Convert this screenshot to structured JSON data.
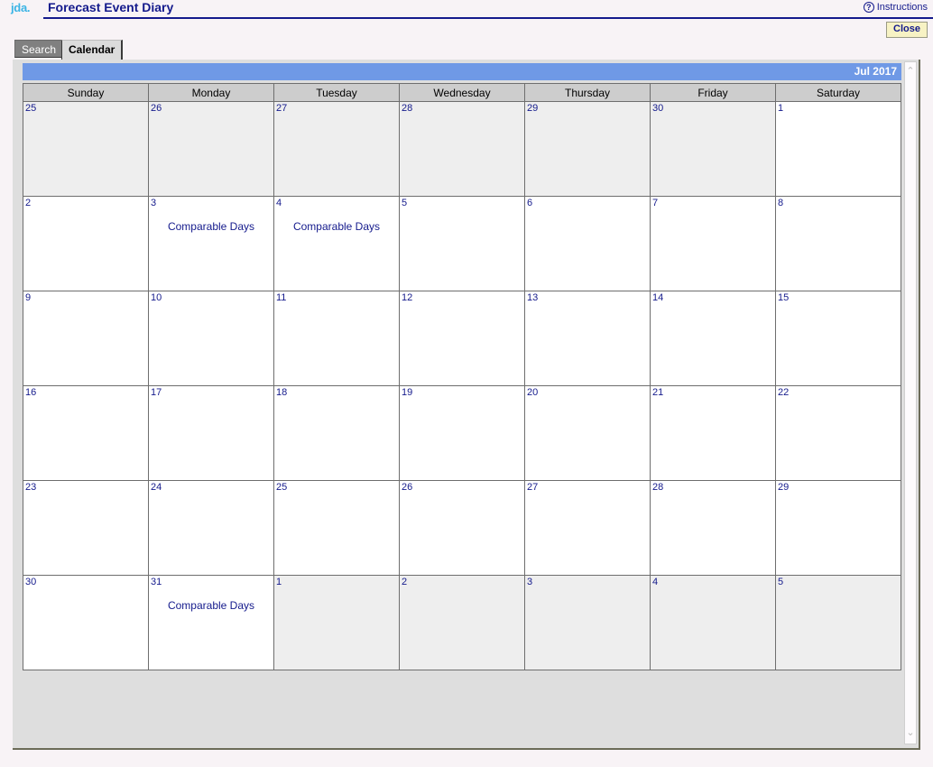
{
  "header": {
    "logo": "jda.",
    "title": "Forecast Event Diary",
    "instructions_label": "Instructions",
    "instructions_icon": "question-circle-icon",
    "close_label": "Close"
  },
  "tabs": [
    {
      "label": "Search",
      "active": false
    },
    {
      "label": "Calendar",
      "active": true
    }
  ],
  "calendar": {
    "month_label": "Jul 2017",
    "weekday_headers": [
      "Sunday",
      "Monday",
      "Tuesday",
      "Wednesday",
      "Thursday",
      "Friday",
      "Saturday"
    ],
    "event_label": "Comparable Days",
    "weeks": [
      [
        {
          "day": "25",
          "other_month": true,
          "event": ""
        },
        {
          "day": "26",
          "other_month": true,
          "event": ""
        },
        {
          "day": "27",
          "other_month": true,
          "event": ""
        },
        {
          "day": "28",
          "other_month": true,
          "event": ""
        },
        {
          "day": "29",
          "other_month": true,
          "event": ""
        },
        {
          "day": "30",
          "other_month": true,
          "event": ""
        },
        {
          "day": "1",
          "other_month": false,
          "event": ""
        }
      ],
      [
        {
          "day": "2",
          "other_month": false,
          "event": ""
        },
        {
          "day": "3",
          "other_month": false,
          "event": "Comparable Days"
        },
        {
          "day": "4",
          "other_month": false,
          "event": "Comparable Days"
        },
        {
          "day": "5",
          "other_month": false,
          "event": ""
        },
        {
          "day": "6",
          "other_month": false,
          "event": ""
        },
        {
          "day": "7",
          "other_month": false,
          "event": ""
        },
        {
          "day": "8",
          "other_month": false,
          "event": ""
        }
      ],
      [
        {
          "day": "9",
          "other_month": false,
          "event": ""
        },
        {
          "day": "10",
          "other_month": false,
          "event": ""
        },
        {
          "day": "11",
          "other_month": false,
          "event": ""
        },
        {
          "day": "12",
          "other_month": false,
          "event": ""
        },
        {
          "day": "13",
          "other_month": false,
          "event": ""
        },
        {
          "day": "14",
          "other_month": false,
          "event": ""
        },
        {
          "day": "15",
          "other_month": false,
          "event": ""
        }
      ],
      [
        {
          "day": "16",
          "other_month": false,
          "event": ""
        },
        {
          "day": "17",
          "other_month": false,
          "event": ""
        },
        {
          "day": "18",
          "other_month": false,
          "event": ""
        },
        {
          "day": "19",
          "other_month": false,
          "event": ""
        },
        {
          "day": "20",
          "other_month": false,
          "event": ""
        },
        {
          "day": "21",
          "other_month": false,
          "event": ""
        },
        {
          "day": "22",
          "other_month": false,
          "event": ""
        }
      ],
      [
        {
          "day": "23",
          "other_month": false,
          "event": ""
        },
        {
          "day": "24",
          "other_month": false,
          "event": ""
        },
        {
          "day": "25",
          "other_month": false,
          "event": ""
        },
        {
          "day": "26",
          "other_month": false,
          "event": ""
        },
        {
          "day": "27",
          "other_month": false,
          "event": ""
        },
        {
          "day": "28",
          "other_month": false,
          "event": ""
        },
        {
          "day": "29",
          "other_month": false,
          "event": ""
        }
      ],
      [
        {
          "day": "30",
          "other_month": false,
          "event": ""
        },
        {
          "day": "31",
          "other_month": false,
          "event": "Comparable Days"
        },
        {
          "day": "1",
          "other_month": true,
          "event": ""
        },
        {
          "day": "2",
          "other_month": true,
          "event": ""
        },
        {
          "day": "3",
          "other_month": true,
          "event": ""
        },
        {
          "day": "4",
          "other_month": true,
          "event": ""
        },
        {
          "day": "5",
          "other_month": true,
          "event": ""
        }
      ]
    ]
  },
  "scrollbar": {
    "up_glyph": "⌃",
    "down_glyph": "⌄"
  },
  "colors": {
    "month_bar": "#6f99e6",
    "text_navy": "#141a8c",
    "logo_cyan": "#3bb4e5",
    "close_yellow": "#f7f2c4",
    "other_month_bg": "#eeeeee"
  }
}
